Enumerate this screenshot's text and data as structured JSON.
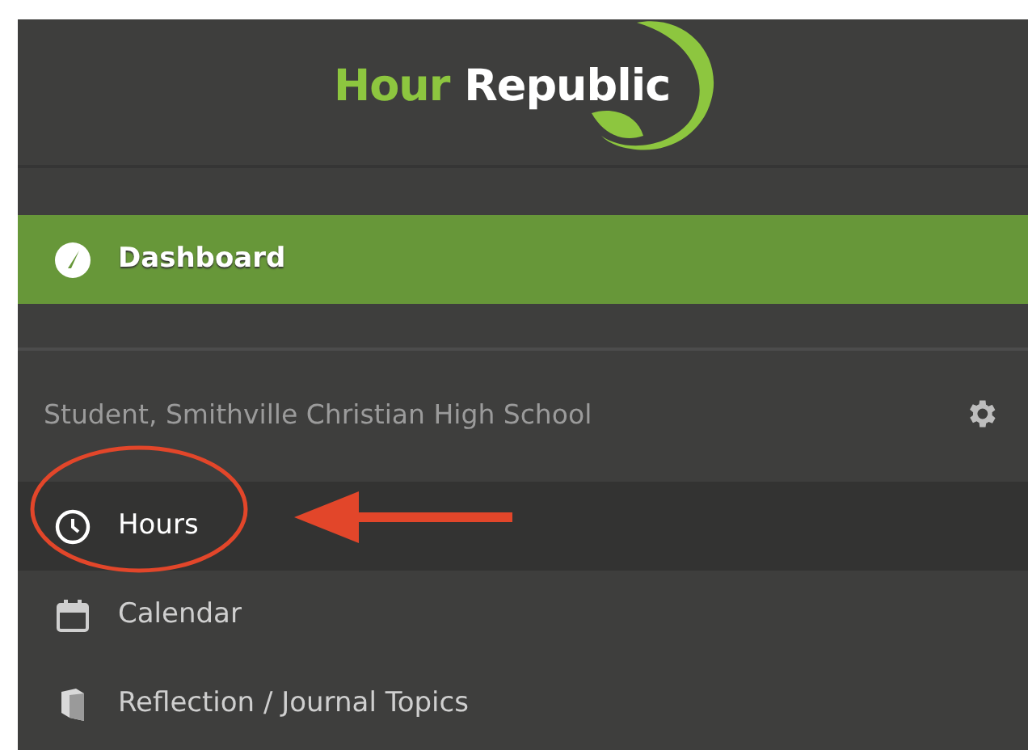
{
  "logo": {
    "first_word": "Hour",
    "second_word": "Republic"
  },
  "main_nav": [
    {
      "label": "Dashboard",
      "kind": "gauge",
      "selected": true
    }
  ],
  "section": {
    "title": "Student, Smithville Christian High School",
    "items": [
      {
        "label": "Hours",
        "kind": "clock",
        "highlighted": true
      },
      {
        "label": "Calendar",
        "kind": "calendar",
        "highlighted": false
      },
      {
        "label": "Reflection / Journal Topics",
        "kind": "book",
        "highlighted": false
      }
    ]
  },
  "annotation": {
    "kind": "circle-and-arrow"
  }
}
